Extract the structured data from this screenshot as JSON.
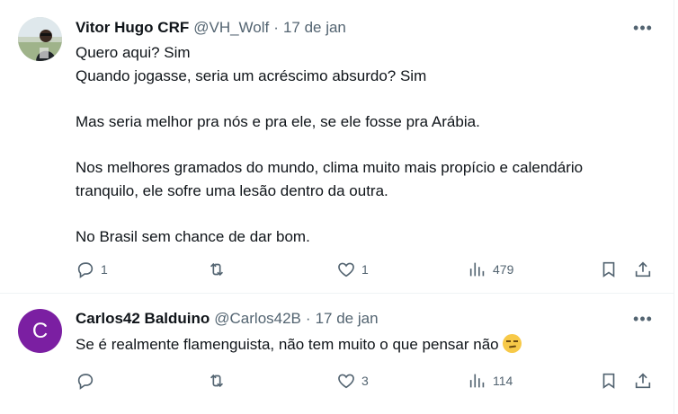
{
  "tweets": [
    {
      "author": "Vitor Hugo CRF",
      "handle": "@VH_Wolf",
      "separator": "·",
      "date": "17 de jan",
      "more": "•••",
      "lines": [
        "Quero aqui? Sim",
        "Quando jogasse, seria um acréscimo absurdo? Sim",
        "",
        "Mas seria melhor pra nós e pra ele, se ele fosse pra Arábia.",
        "",
        "Nos melhores gramados do mundo, clima muito mais propício e calendário",
        "tranquilo, ele sofre uma lesão dentro da outra.",
        "",
        "No Brasil sem chance de dar bom."
      ],
      "replies": "1",
      "retweets": "",
      "likes": "1",
      "views": "479"
    },
    {
      "author": "Carlos42 Balduino",
      "handle": "@Carlos42B",
      "separator": "·",
      "date": "17 de jan",
      "more": "•••",
      "avatar_letter": "C",
      "avatar_color": "#7b1fa2",
      "lines": [
        "Se é realmente flamenguista, não tem muito o que pensar não"
      ],
      "emoji": "unamused-face-emoji",
      "replies": "",
      "retweets": "",
      "likes": "3",
      "views": "114"
    }
  ],
  "icons": {
    "reply": "reply-icon",
    "retweet": "retweet-icon",
    "like": "heart-icon",
    "views": "views-icon",
    "bookmark": "bookmark-icon",
    "share": "share-icon"
  },
  "colors": {
    "text": "#0f1419",
    "secondary": "#536471",
    "border": "#eff3f4"
  }
}
